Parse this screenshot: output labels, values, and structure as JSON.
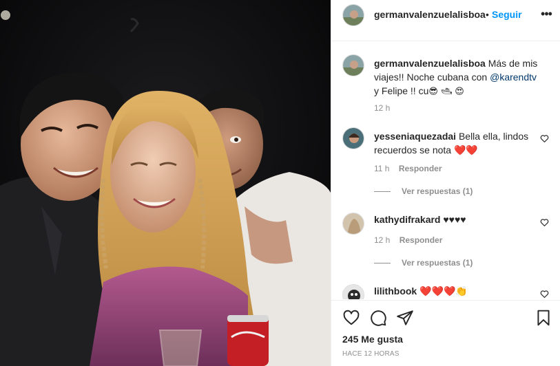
{
  "post": {
    "username": "germanvalenzuelalisboa",
    "separator": "•",
    "follow_label": "Seguir",
    "more_label": "•••",
    "caption": {
      "text_1": "Más de mis viajes!! Noche cubana con ",
      "mention": "@karendtv",
      "text_2": " y Felipe !! cu",
      "emoji_1": "😎",
      "emoji_2": "🛥",
      "emoji_3": "😍",
      "time": "12 h"
    },
    "comments": [
      {
        "username": "yesseniaquezadai",
        "text": " Bella ella, lindos recuerdos se nota ",
        "hearts": "❤️❤️",
        "time": "11 h",
        "reply_label": "Responder",
        "view_replies": "Ver respuestas (1)"
      },
      {
        "username": "kathydifrakard",
        "text": " ♥♥♥♥",
        "time": "12 h",
        "reply_label": "Responder",
        "view_replies": "Ver respuestas (1)"
      },
      {
        "username": "lilithbook",
        "text": " ",
        "hearts": "❤️❤️❤️👏"
      }
    ],
    "likes_label": "245 Me gusta",
    "posted_label": "HACE 12 HORAS"
  },
  "icons": {
    "like": "heart-outline-icon",
    "comment": "speech-bubble-icon",
    "share": "paper-plane-icon",
    "save": "bookmark-icon"
  },
  "colors": {
    "link_blue": "#0095f6",
    "mention_blue": "#00376b",
    "muted": "#8e8e8e",
    "text": "#262626",
    "heart_red": "#ed4956"
  }
}
